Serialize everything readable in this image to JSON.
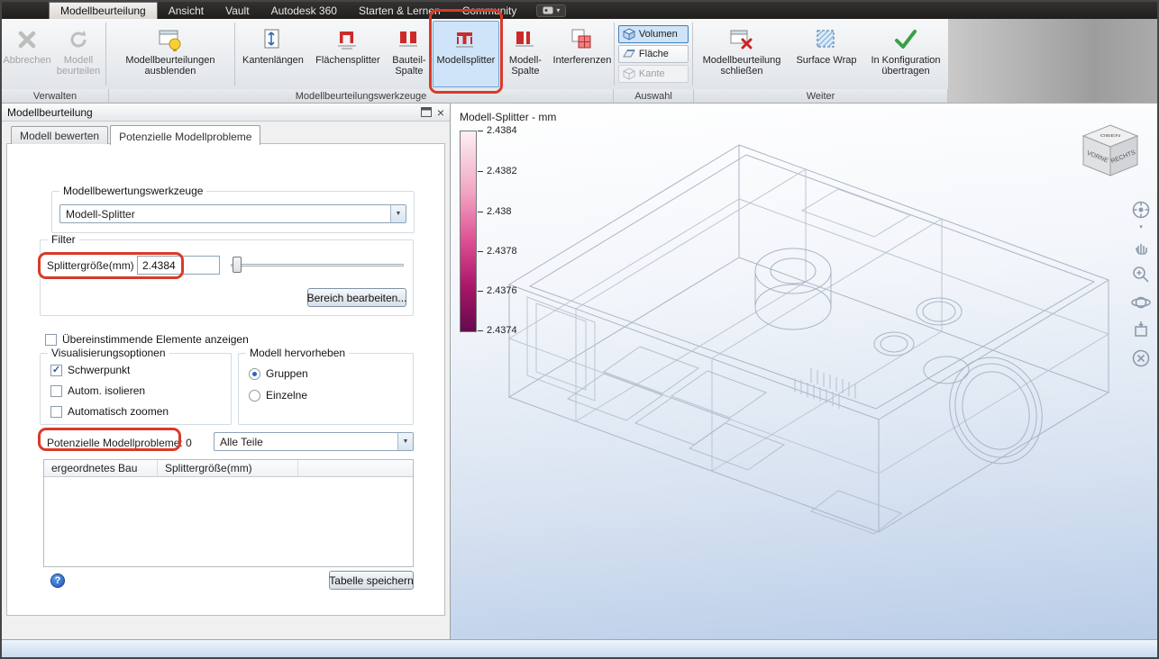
{
  "colors": {
    "annotation_red": "#d93a2a",
    "selection_blue": "#cfe4f8",
    "selection_border": "#6ba6dc",
    "legend_c0": "#fdf0f2",
    "legend_c1": "#f2a6c4",
    "legend_c2": "#dd4f92",
    "legend_c3": "#a81668",
    "legend_c4": "#650a4e"
  },
  "icons": {
    "chevron_down": "▼",
    "caret": "▾",
    "close": "×",
    "check": "✓",
    "help": "?"
  },
  "menubar": {
    "tabs": [
      {
        "label": "Modellbeurteilung",
        "active": true
      },
      {
        "label": "Ansicht",
        "active": false
      },
      {
        "label": "Vault",
        "active": false
      },
      {
        "label": "Autodesk 360",
        "active": false
      },
      {
        "label": "Starten & Lernen",
        "active": false
      },
      {
        "label": "Community",
        "active": false
      }
    ]
  },
  "ribbon": {
    "buttons": {
      "abbrechen": "Abbrechen",
      "modell_beurteilen": "Modell beurteilen",
      "ausblenden": "Modellbeurteilungen ausblenden",
      "kantenlaengen": "Kantenlängen",
      "flaechensplitter": "Flächensplitter",
      "bauteil_spalte": "Bauteil-Spalte",
      "modellsplitter": "Modellsplitter",
      "modell_spalte": "Modell-Spalte",
      "interferenzen": "Interferenzen",
      "volumen": "Volumen",
      "flaeche": "Fläche",
      "kante": "Kante",
      "schliessen": "Modellbeurteilung schließen",
      "surface_wrap": "Surface Wrap",
      "in_konfiguration": "In Konfiguration übertragen"
    },
    "state": {
      "abbrechen_disabled": true,
      "modell_beurteilen_disabled": true,
      "modellsplitter_selected": true,
      "volumen_selected": true,
      "kante_disabled": true
    },
    "group_labels": [
      "Verwalten",
      "Modellbeurteilungswerkzeuge",
      "Auswahl",
      "Weiter"
    ]
  },
  "panel": {
    "title": "Modellbeurteilung",
    "tabs": [
      {
        "label": "Modell bewerten",
        "active": false
      },
      {
        "label": "Potenzielle Modellprobleme",
        "active": true
      }
    ],
    "werkzeuge_group": "Modellbewertungswerkzeuge",
    "werkzeuge_value": "Modell-Splitter",
    "filter": {
      "group": "Filter",
      "label": "Splittergröße(mm)",
      "value": "2.4384",
      "bereich_button": "Bereich bearbeiten..."
    },
    "uebereinstimmende": {
      "label": "Übereinstimmende Elemente anzeigen",
      "checked": false
    },
    "visualisierung": {
      "group": "Visualisierungsoptionen",
      "options": [
        {
          "label": "Schwerpunkt",
          "checked": true
        },
        {
          "label": "Autom. isolieren",
          "checked": false
        },
        {
          "label": "Automatisch zoomen",
          "checked": false
        }
      ]
    },
    "hervorheben": {
      "group": "Modell hervorheben",
      "options": [
        {
          "label": "Gruppen",
          "selected": true
        },
        {
          "label": "Einzelne",
          "selected": false
        }
      ]
    },
    "probleme_label": "Potenzielle Modellprobleme: 0",
    "teile_filter_value": "Alle Teile",
    "table": {
      "headers": [
        "ergeordnetes Bau",
        "Splittergröße(mm)"
      ]
    },
    "save_button": "Tabelle speichern"
  },
  "viewport": {
    "legend": {
      "title": "Modell-Splitter - mm",
      "ticks": [
        "2.4384",
        "2.4382",
        "2.438",
        "2.4378",
        "2.4376",
        "2.4374"
      ]
    },
    "viewcube": {
      "top": "OBEN",
      "front": "VORNE",
      "right": "RECHTS"
    }
  }
}
